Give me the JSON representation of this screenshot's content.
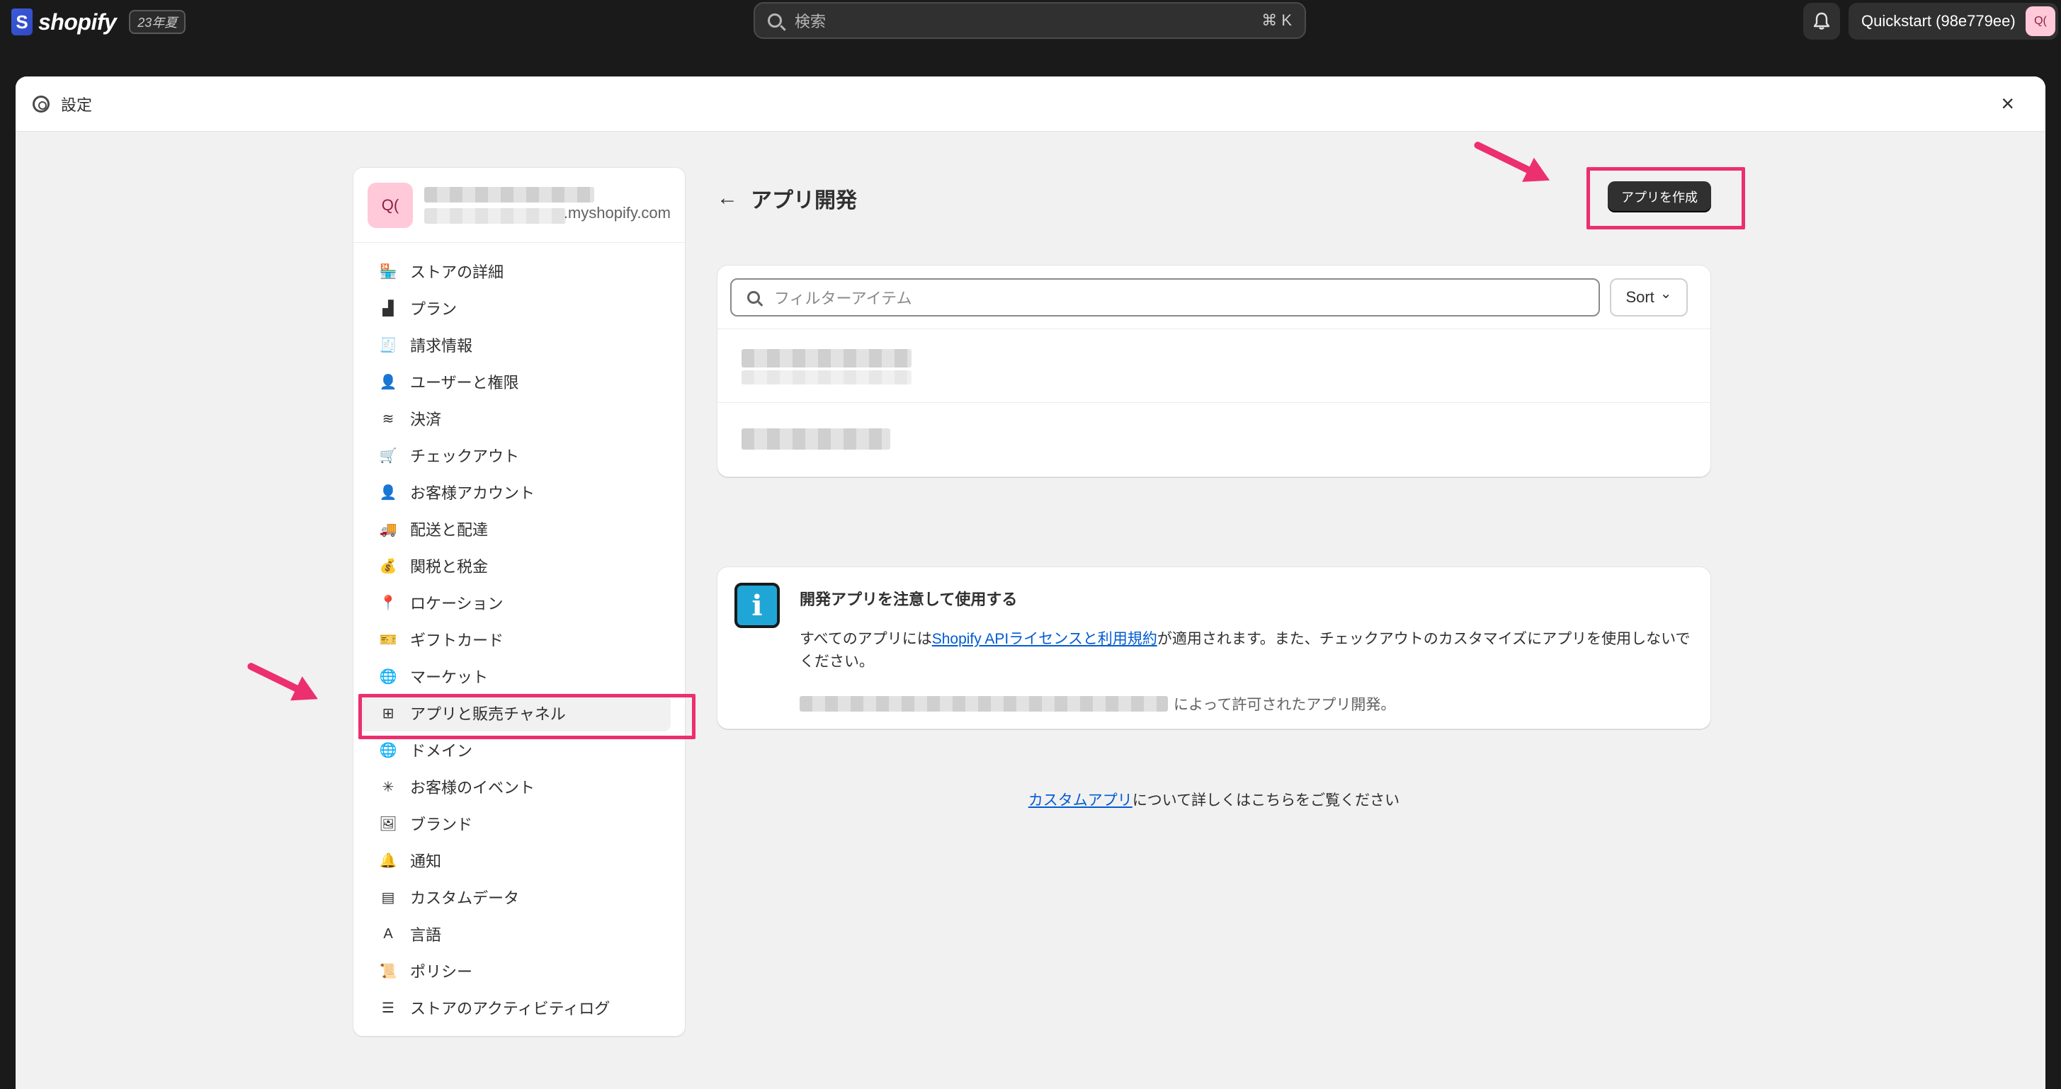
{
  "topbar": {
    "logo_text": "shopify",
    "logo_glyph": "S",
    "edition_badge": "23年夏",
    "search_placeholder": "検索",
    "search_shortcut": "⌘ K",
    "store_button_label": "Quickstart (98e779ee)",
    "avatar_initials": "Q("
  },
  "modal": {
    "title": "設定",
    "close_glyph": "×"
  },
  "sidebar": {
    "store_initials": "Q(",
    "store_domain": ".myshopify.com",
    "items": [
      {
        "label": "ストアの詳細",
        "icon": "🏪"
      },
      {
        "label": "プラン",
        "icon": "▟"
      },
      {
        "label": "請求情報",
        "icon": "🧾"
      },
      {
        "label": "ユーザーと権限",
        "icon": "👤"
      },
      {
        "label": "決済",
        "icon": "≋"
      },
      {
        "label": "チェックアウト",
        "icon": "🛒"
      },
      {
        "label": "お客様アカウント",
        "icon": "👤"
      },
      {
        "label": "配送と配達",
        "icon": "🚚"
      },
      {
        "label": "関税と税金",
        "icon": "💰"
      },
      {
        "label": "ロケーション",
        "icon": "📍"
      },
      {
        "label": "ギフトカード",
        "icon": "🎫"
      },
      {
        "label": "マーケット",
        "icon": "🌐"
      },
      {
        "label": "アプリと販売チャネル",
        "icon": "⊞"
      },
      {
        "label": "ドメイン",
        "icon": "🌐"
      },
      {
        "label": "お客様のイベント",
        "icon": "✳"
      },
      {
        "label": "ブランド",
        "icon": "🖼"
      },
      {
        "label": "通知",
        "icon": "🔔"
      },
      {
        "label": "カスタムデータ",
        "icon": "▤"
      },
      {
        "label": "言語",
        "icon": "A"
      },
      {
        "label": "ポリシー",
        "icon": "📜"
      },
      {
        "label": "ストアのアクティビティログ",
        "icon": "☰"
      }
    ]
  },
  "main": {
    "back_glyph": "←",
    "page_title": "アプリ開発",
    "create_button": "アプリを作成",
    "filter_placeholder": "フィルターアイテム",
    "sort_label": "Sort",
    "sort_chevron": "⌄",
    "notice": {
      "icon_glyph": "i",
      "title": "開発アプリを注意して使用する",
      "body_prefix": "すべてのアプリには",
      "body_link": "Shopify APIライセンスと利用規約",
      "body_suffix": "が適用されます。また、チェックアウトのカスタマイズにアプリを使用しないでください。",
      "footer_suffix": "によって許可されたアプリ開発。"
    },
    "footer_link": "カスタムアプリ",
    "footer_suffix": "について詳しくはこちらをご覧ください"
  },
  "annotation_color": "#ec2f6f"
}
